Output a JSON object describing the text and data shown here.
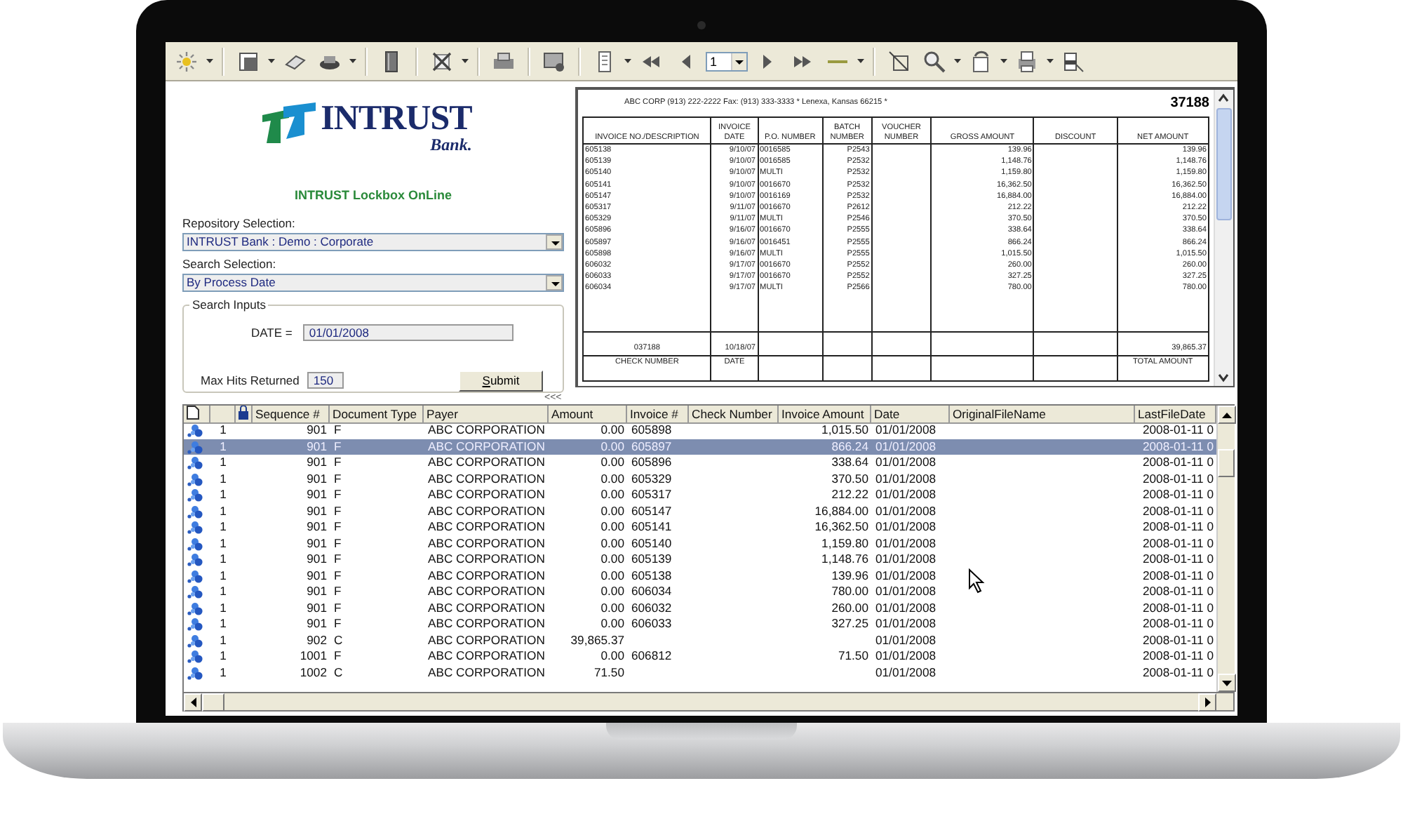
{
  "toolbar": {
    "page_number": "1"
  },
  "branding": {
    "logo_name": "INTRUST",
    "logo_sub": "Bank.",
    "app_title": "INTRUST Lockbox OnLine"
  },
  "search_panel": {
    "repository_label": "Repository Selection:",
    "repository_value": "INTRUST Bank : Demo : Corporate",
    "search_label": "Search Selection:",
    "search_value": "By Process Date",
    "group_title": "Search Inputs",
    "date_label": "DATE  =",
    "date_value": "01/01/2008",
    "max_hits_label": "Max Hits Returned",
    "max_hits_value": "150",
    "submit_label": "Submit"
  },
  "splitter": "<<<",
  "document": {
    "header": "ABC CORP (913) 222-2222  Fax: (913) 333-3333   * Lenexa, Kansas 66215 *",
    "number": "37188",
    "columns": [
      "INVOICE NO./DESCRIPTION",
      "INVOICE DATE",
      "P.O. NUMBER",
      "BATCH NUMBER",
      "VOUCHER NUMBER",
      "GROSS AMOUNT",
      "DISCOUNT",
      "NET AMOUNT"
    ],
    "rows": [
      {
        "invoice": "605138",
        "date": "9/10/07",
        "po": "0016585",
        "batch": "P2543",
        "gross": "139.96",
        "net": "139.96"
      },
      {
        "invoice": "605139",
        "date": "9/10/07",
        "po": "0016585",
        "batch": "P2532",
        "gross": "1,148.76",
        "net": "1,148.76"
      },
      {
        "invoice": "605140",
        "date": "9/10/07",
        "po": "MULTI",
        "batch": "P2532",
        "gross": "1,159.80",
        "net": "1,159.80"
      },
      {
        "invoice": "605141",
        "date": "9/10/07",
        "po": "0016670",
        "batch": "P2532",
        "gross": "16,362.50",
        "net": "16,362.50"
      },
      {
        "invoice": "605147",
        "date": "9/10/07",
        "po": "0016169",
        "batch": "P2532",
        "gross": "16,884.00",
        "net": "16,884.00"
      },
      {
        "invoice": "605317",
        "date": "9/11/07",
        "po": "0016670",
        "batch": "P2612",
        "gross": "212.22",
        "net": "212.22"
      },
      {
        "invoice": "605329",
        "date": "9/11/07",
        "po": "MULTI",
        "batch": "P2546",
        "gross": "370.50",
        "net": "370.50"
      },
      {
        "invoice": "605896",
        "date": "9/16/07",
        "po": "0016670",
        "batch": "P2555",
        "gross": "338.64",
        "net": "338.64"
      },
      {
        "invoice": "605897",
        "date": "9/16/07",
        "po": "0016451",
        "batch": "P2555",
        "gross": "866.24",
        "net": "866.24"
      },
      {
        "invoice": "605898",
        "date": "9/16/07",
        "po": "MULTI",
        "batch": "P2555",
        "gross": "1,015.50",
        "net": "1,015.50"
      },
      {
        "invoice": "606032",
        "date": "9/17/07",
        "po": "0016670",
        "batch": "P2552",
        "gross": "260.00",
        "net": "260.00"
      },
      {
        "invoice": "606033",
        "date": "9/17/07",
        "po": "0016670",
        "batch": "P2552",
        "gross": "327.25",
        "net": "327.25"
      },
      {
        "invoice": "606034",
        "date": "9/17/07",
        "po": "MULTI",
        "batch": "P2566",
        "gross": "780.00",
        "net": "780.00"
      }
    ],
    "check_number": "037188",
    "check_date": "10/18/07",
    "total_amount": "39,865.37",
    "footer_labels": {
      "check_number": "CHECK NUMBER",
      "date": "DATE",
      "total": "TOTAL AMOUNT"
    }
  },
  "grid": {
    "columns": [
      "Sequence #",
      "Document Type",
      "Payer",
      "Amount",
      "Invoice #",
      "Check Number",
      "Invoice Amount",
      "Date",
      "OriginalFileName",
      "LastFileDate"
    ],
    "rows": [
      {
        "selected": false,
        "n": "1",
        "seq": "901",
        "type": "F",
        "payer": "ABC CORPORATION",
        "amount": "0.00",
        "invoice": "605898",
        "inv_amount": "1,015.50",
        "date": "01/01/2008",
        "last": "2008-01-11 0"
      },
      {
        "selected": true,
        "n": "1",
        "seq": "901",
        "type": "F",
        "payer": "ABC CORPORATION",
        "amount": "0.00",
        "invoice": "605897",
        "inv_amount": "866.24",
        "date": "01/01/2008",
        "last": "2008-01-11 0"
      },
      {
        "selected": false,
        "n": "1",
        "seq": "901",
        "type": "F",
        "payer": "ABC CORPORATION",
        "amount": "0.00",
        "invoice": "605896",
        "inv_amount": "338.64",
        "date": "01/01/2008",
        "last": "2008-01-11 0"
      },
      {
        "selected": false,
        "n": "1",
        "seq": "901",
        "type": "F",
        "payer": "ABC CORPORATION",
        "amount": "0.00",
        "invoice": "605329",
        "inv_amount": "370.50",
        "date": "01/01/2008",
        "last": "2008-01-11 0"
      },
      {
        "selected": false,
        "n": "1",
        "seq": "901",
        "type": "F",
        "payer": "ABC CORPORATION",
        "amount": "0.00",
        "invoice": "605317",
        "inv_amount": "212.22",
        "date": "01/01/2008",
        "last": "2008-01-11 0"
      },
      {
        "selected": false,
        "n": "1",
        "seq": "901",
        "type": "F",
        "payer": "ABC CORPORATION",
        "amount": "0.00",
        "invoice": "605147",
        "inv_amount": "16,884.00",
        "date": "01/01/2008",
        "last": "2008-01-11 0"
      },
      {
        "selected": false,
        "n": "1",
        "seq": "901",
        "type": "F",
        "payer": "ABC CORPORATION",
        "amount": "0.00",
        "invoice": "605141",
        "inv_amount": "16,362.50",
        "date": "01/01/2008",
        "last": "2008-01-11 0"
      },
      {
        "selected": false,
        "n": "1",
        "seq": "901",
        "type": "F",
        "payer": "ABC CORPORATION",
        "amount": "0.00",
        "invoice": "605140",
        "inv_amount": "1,159.80",
        "date": "01/01/2008",
        "last": "2008-01-11 0"
      },
      {
        "selected": false,
        "n": "1",
        "seq": "901",
        "type": "F",
        "payer": "ABC CORPORATION",
        "amount": "0.00",
        "invoice": "605139",
        "inv_amount": "1,148.76",
        "date": "01/01/2008",
        "last": "2008-01-11 0"
      },
      {
        "selected": false,
        "n": "1",
        "seq": "901",
        "type": "F",
        "payer": "ABC CORPORATION",
        "amount": "0.00",
        "invoice": "605138",
        "inv_amount": "139.96",
        "date": "01/01/2008",
        "last": "2008-01-11 0"
      },
      {
        "selected": false,
        "n": "1",
        "seq": "901",
        "type": "F",
        "payer": "ABC CORPORATION",
        "amount": "0.00",
        "invoice": "606034",
        "inv_amount": "780.00",
        "date": "01/01/2008",
        "last": "2008-01-11 0"
      },
      {
        "selected": false,
        "n": "1",
        "seq": "901",
        "type": "F",
        "payer": "ABC CORPORATION",
        "amount": "0.00",
        "invoice": "606032",
        "inv_amount": "260.00",
        "date": "01/01/2008",
        "last": "2008-01-11 0"
      },
      {
        "selected": false,
        "n": "1",
        "seq": "901",
        "type": "F",
        "payer": "ABC CORPORATION",
        "amount": "0.00",
        "invoice": "606033",
        "inv_amount": "327.25",
        "date": "01/01/2008",
        "last": "2008-01-11 0"
      },
      {
        "selected": false,
        "n": "1",
        "seq": "902",
        "type": "C",
        "payer": "ABC CORPORATION",
        "amount": "39,865.37",
        "date": "01/01/2008",
        "last": "2008-01-11 0"
      },
      {
        "selected": false,
        "n": "1",
        "seq": "1001",
        "type": "F",
        "payer": "ABC CORPORATION",
        "amount": "0.00",
        "invoice": "606812",
        "inv_amount": "71.50",
        "date": "01/01/2008",
        "last": "2008-01-11 0"
      },
      {
        "selected": false,
        "n": "1",
        "seq": "1002",
        "type": "C",
        "payer": "ABC CORPORATION",
        "amount": "71.50",
        "date": "01/01/2008",
        "last": "2008-01-11 0"
      }
    ]
  }
}
